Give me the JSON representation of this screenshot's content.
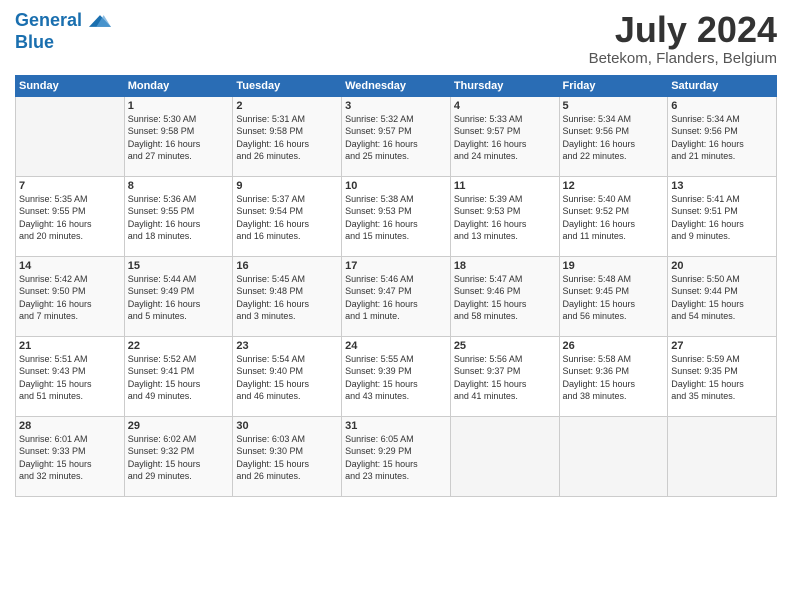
{
  "header": {
    "logo_line1": "General",
    "logo_line2": "Blue",
    "month_year": "July 2024",
    "location": "Betekom, Flanders, Belgium"
  },
  "days_of_week": [
    "Sunday",
    "Monday",
    "Tuesday",
    "Wednesday",
    "Thursday",
    "Friday",
    "Saturday"
  ],
  "weeks": [
    [
      {
        "num": "",
        "info": ""
      },
      {
        "num": "1",
        "info": "Sunrise: 5:30 AM\nSunset: 9:58 PM\nDaylight: 16 hours\nand 27 minutes."
      },
      {
        "num": "2",
        "info": "Sunrise: 5:31 AM\nSunset: 9:58 PM\nDaylight: 16 hours\nand 26 minutes."
      },
      {
        "num": "3",
        "info": "Sunrise: 5:32 AM\nSunset: 9:57 PM\nDaylight: 16 hours\nand 25 minutes."
      },
      {
        "num": "4",
        "info": "Sunrise: 5:33 AM\nSunset: 9:57 PM\nDaylight: 16 hours\nand 24 minutes."
      },
      {
        "num": "5",
        "info": "Sunrise: 5:34 AM\nSunset: 9:56 PM\nDaylight: 16 hours\nand 22 minutes."
      },
      {
        "num": "6",
        "info": "Sunrise: 5:34 AM\nSunset: 9:56 PM\nDaylight: 16 hours\nand 21 minutes."
      }
    ],
    [
      {
        "num": "7",
        "info": "Sunrise: 5:35 AM\nSunset: 9:55 PM\nDaylight: 16 hours\nand 20 minutes."
      },
      {
        "num": "8",
        "info": "Sunrise: 5:36 AM\nSunset: 9:55 PM\nDaylight: 16 hours\nand 18 minutes."
      },
      {
        "num": "9",
        "info": "Sunrise: 5:37 AM\nSunset: 9:54 PM\nDaylight: 16 hours\nand 16 minutes."
      },
      {
        "num": "10",
        "info": "Sunrise: 5:38 AM\nSunset: 9:53 PM\nDaylight: 16 hours\nand 15 minutes."
      },
      {
        "num": "11",
        "info": "Sunrise: 5:39 AM\nSunset: 9:53 PM\nDaylight: 16 hours\nand 13 minutes."
      },
      {
        "num": "12",
        "info": "Sunrise: 5:40 AM\nSunset: 9:52 PM\nDaylight: 16 hours\nand 11 minutes."
      },
      {
        "num": "13",
        "info": "Sunrise: 5:41 AM\nSunset: 9:51 PM\nDaylight: 16 hours\nand 9 minutes."
      }
    ],
    [
      {
        "num": "14",
        "info": "Sunrise: 5:42 AM\nSunset: 9:50 PM\nDaylight: 16 hours\nand 7 minutes."
      },
      {
        "num": "15",
        "info": "Sunrise: 5:44 AM\nSunset: 9:49 PM\nDaylight: 16 hours\nand 5 minutes."
      },
      {
        "num": "16",
        "info": "Sunrise: 5:45 AM\nSunset: 9:48 PM\nDaylight: 16 hours\nand 3 minutes."
      },
      {
        "num": "17",
        "info": "Sunrise: 5:46 AM\nSunset: 9:47 PM\nDaylight: 16 hours\nand 1 minute."
      },
      {
        "num": "18",
        "info": "Sunrise: 5:47 AM\nSunset: 9:46 PM\nDaylight: 15 hours\nand 58 minutes."
      },
      {
        "num": "19",
        "info": "Sunrise: 5:48 AM\nSunset: 9:45 PM\nDaylight: 15 hours\nand 56 minutes."
      },
      {
        "num": "20",
        "info": "Sunrise: 5:50 AM\nSunset: 9:44 PM\nDaylight: 15 hours\nand 54 minutes."
      }
    ],
    [
      {
        "num": "21",
        "info": "Sunrise: 5:51 AM\nSunset: 9:43 PM\nDaylight: 15 hours\nand 51 minutes."
      },
      {
        "num": "22",
        "info": "Sunrise: 5:52 AM\nSunset: 9:41 PM\nDaylight: 15 hours\nand 49 minutes."
      },
      {
        "num": "23",
        "info": "Sunrise: 5:54 AM\nSunset: 9:40 PM\nDaylight: 15 hours\nand 46 minutes."
      },
      {
        "num": "24",
        "info": "Sunrise: 5:55 AM\nSunset: 9:39 PM\nDaylight: 15 hours\nand 43 minutes."
      },
      {
        "num": "25",
        "info": "Sunrise: 5:56 AM\nSunset: 9:37 PM\nDaylight: 15 hours\nand 41 minutes."
      },
      {
        "num": "26",
        "info": "Sunrise: 5:58 AM\nSunset: 9:36 PM\nDaylight: 15 hours\nand 38 minutes."
      },
      {
        "num": "27",
        "info": "Sunrise: 5:59 AM\nSunset: 9:35 PM\nDaylight: 15 hours\nand 35 minutes."
      }
    ],
    [
      {
        "num": "28",
        "info": "Sunrise: 6:01 AM\nSunset: 9:33 PM\nDaylight: 15 hours\nand 32 minutes."
      },
      {
        "num": "29",
        "info": "Sunrise: 6:02 AM\nSunset: 9:32 PM\nDaylight: 15 hours\nand 29 minutes."
      },
      {
        "num": "30",
        "info": "Sunrise: 6:03 AM\nSunset: 9:30 PM\nDaylight: 15 hours\nand 26 minutes."
      },
      {
        "num": "31",
        "info": "Sunrise: 6:05 AM\nSunset: 9:29 PM\nDaylight: 15 hours\nand 23 minutes."
      },
      {
        "num": "",
        "info": ""
      },
      {
        "num": "",
        "info": ""
      },
      {
        "num": "",
        "info": ""
      }
    ]
  ]
}
